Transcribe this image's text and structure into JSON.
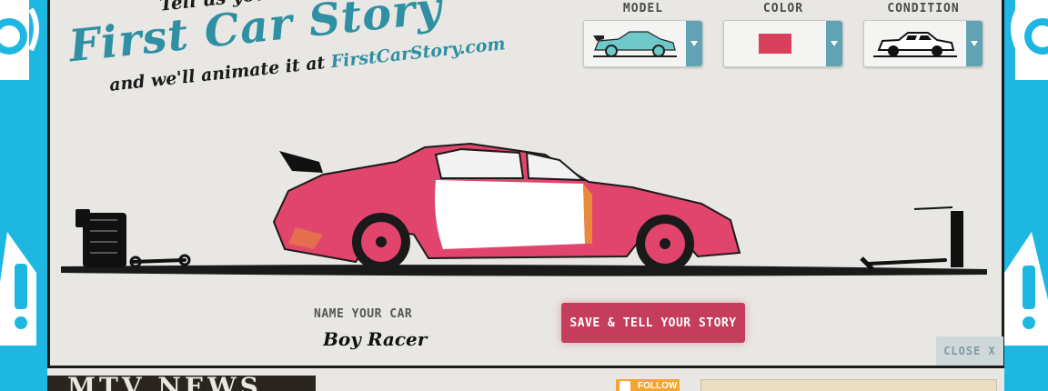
{
  "header": {
    "tagline_top": "Tell us your",
    "logo": "First Car Story",
    "subtitle": "and we'll animate it at",
    "url": "FirstCarStory.com"
  },
  "selectors": [
    {
      "label": "MODEL",
      "icon": "sports-car-thumbnail-icon",
      "value_color": "#6fc9c8"
    },
    {
      "label": "COLOR",
      "icon": "color-swatch-icon",
      "value_color": "#d9405c"
    },
    {
      "label": "CONDITION",
      "icon": "beat-up-car-thumbnail-icon",
      "value_color": "#1a1a1a"
    }
  ],
  "car": {
    "body_color": "#e1456d",
    "door_color": "#ffffff",
    "rust_color": "#e88a3a"
  },
  "form": {
    "name_label": "NAME YOUR CAR",
    "name_value": "Boy Racer",
    "save_label": "SAVE & TELL YOUR STORY",
    "close_label": "CLOSE X"
  },
  "footer": {
    "news_title": "MTV NEWS",
    "follow_label": "FOLLOW"
  },
  "colors": {
    "accent_blue": "#1fb8e3",
    "logo_teal": "#2f8fa3",
    "button_pink": "#c43d5b",
    "panel_bg": "#e8e7e3"
  }
}
